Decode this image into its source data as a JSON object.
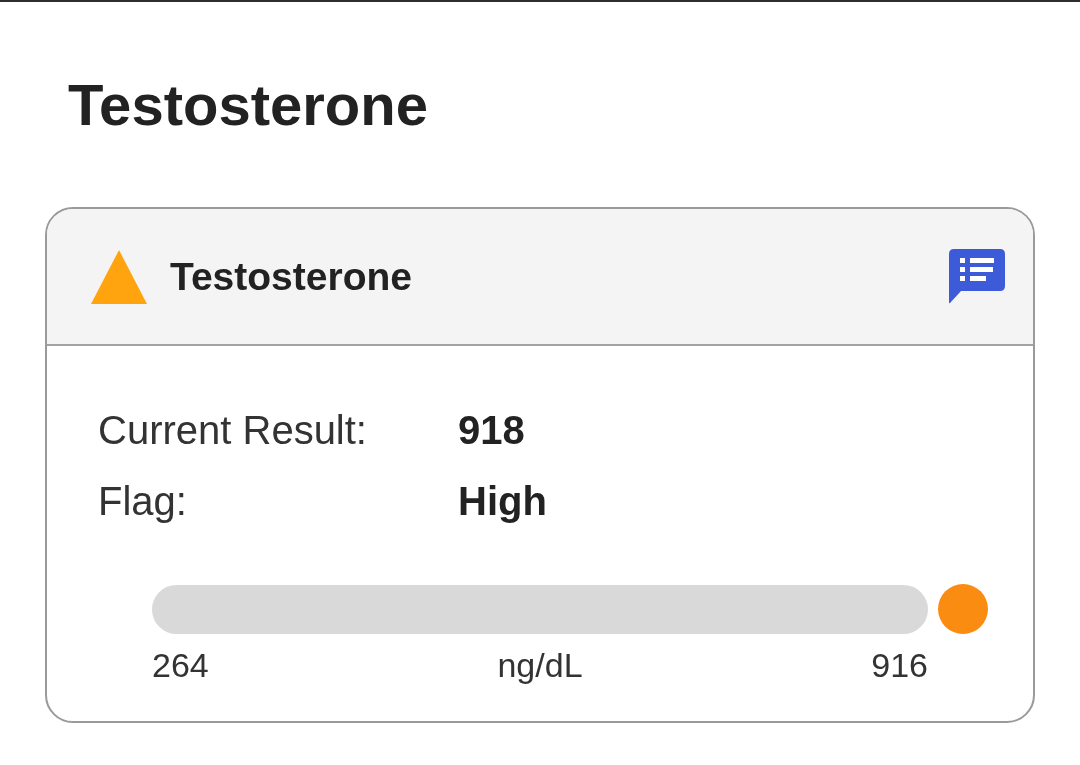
{
  "page_title": "Testosterone",
  "card": {
    "title": "Testosterone",
    "flagged": true,
    "fields": [
      {
        "label": "Current Result:",
        "value": "918"
      },
      {
        "label": "Flag:",
        "value": "High"
      }
    ],
    "range": {
      "low": "264",
      "unit": "ng/dL",
      "high": "916",
      "above_range": true
    }
  }
}
